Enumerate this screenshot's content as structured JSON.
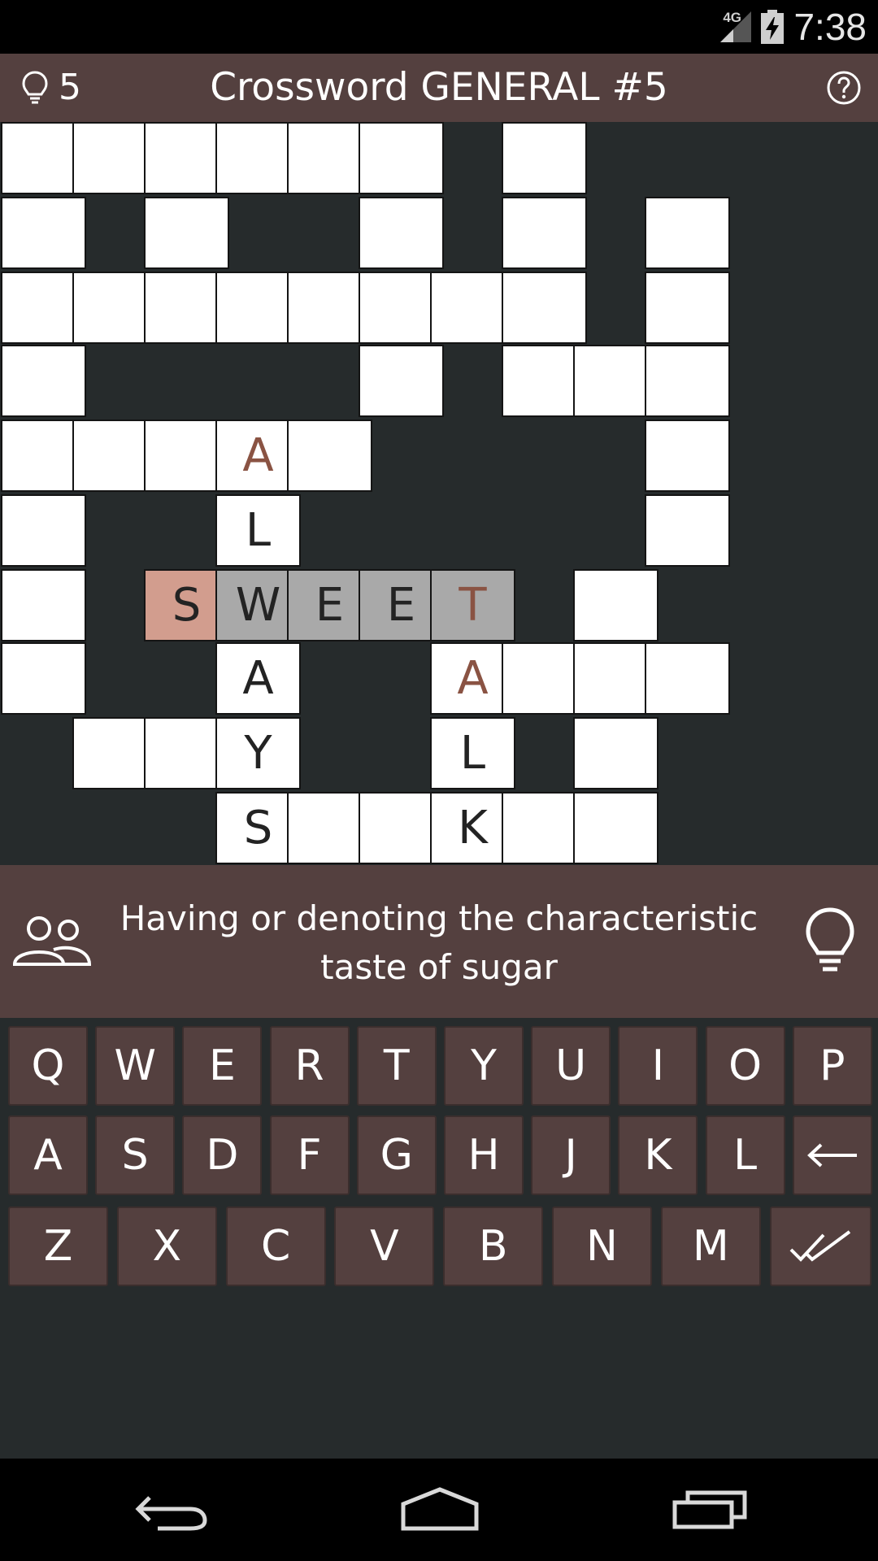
{
  "status_bar": {
    "network": "4G",
    "time": "7:38"
  },
  "header": {
    "hints_left": "5",
    "title": "Crossword GENERAL #5"
  },
  "grid": {
    "cells": [
      {
        "r": 0,
        "c": 0,
        "letter": ""
      },
      {
        "r": 0,
        "c": 1,
        "letter": ""
      },
      {
        "r": 0,
        "c": 2,
        "letter": ""
      },
      {
        "r": 0,
        "c": 3,
        "letter": ""
      },
      {
        "r": 0,
        "c": 4,
        "letter": ""
      },
      {
        "r": 0,
        "c": 5,
        "letter": ""
      },
      {
        "r": 0,
        "c": 7,
        "letter": ""
      },
      {
        "r": 1,
        "c": 0,
        "letter": ""
      },
      {
        "r": 1,
        "c": 2,
        "letter": ""
      },
      {
        "r": 1,
        "c": 5,
        "letter": ""
      },
      {
        "r": 1,
        "c": 7,
        "letter": ""
      },
      {
        "r": 1,
        "c": 9,
        "letter": ""
      },
      {
        "r": 2,
        "c": 0,
        "letter": ""
      },
      {
        "r": 2,
        "c": 1,
        "letter": ""
      },
      {
        "r": 2,
        "c": 2,
        "letter": ""
      },
      {
        "r": 2,
        "c": 3,
        "letter": ""
      },
      {
        "r": 2,
        "c": 4,
        "letter": ""
      },
      {
        "r": 2,
        "c": 5,
        "letter": ""
      },
      {
        "r": 2,
        "c": 6,
        "letter": ""
      },
      {
        "r": 2,
        "c": 7,
        "letter": ""
      },
      {
        "r": 2,
        "c": 9,
        "letter": ""
      },
      {
        "r": 3,
        "c": 0,
        "letter": ""
      },
      {
        "r": 3,
        "c": 5,
        "letter": ""
      },
      {
        "r": 3,
        "c": 7,
        "letter": ""
      },
      {
        "r": 3,
        "c": 8,
        "letter": ""
      },
      {
        "r": 3,
        "c": 9,
        "letter": ""
      },
      {
        "r": 4,
        "c": 0,
        "letter": ""
      },
      {
        "r": 4,
        "c": 1,
        "letter": ""
      },
      {
        "r": 4,
        "c": 2,
        "letter": ""
      },
      {
        "r": 4,
        "c": 3,
        "letter": "A",
        "state": "hinted"
      },
      {
        "r": 4,
        "c": 4,
        "letter": ""
      },
      {
        "r": 4,
        "c": 9,
        "letter": ""
      },
      {
        "r": 5,
        "c": 0,
        "letter": ""
      },
      {
        "r": 5,
        "c": 3,
        "letter": "L"
      },
      {
        "r": 5,
        "c": 9,
        "letter": ""
      },
      {
        "r": 6,
        "c": 0,
        "letter": ""
      },
      {
        "r": 6,
        "c": 2,
        "letter": "S",
        "state": "cursor"
      },
      {
        "r": 6,
        "c": 3,
        "letter": "W",
        "state": "active"
      },
      {
        "r": 6,
        "c": 4,
        "letter": "E",
        "state": "active"
      },
      {
        "r": 6,
        "c": 5,
        "letter": "E",
        "state": "active"
      },
      {
        "r": 6,
        "c": 6,
        "letter": "T",
        "state": "active-hinted"
      },
      {
        "r": 6,
        "c": 8,
        "letter": ""
      },
      {
        "r": 7,
        "c": 0,
        "letter": ""
      },
      {
        "r": 7,
        "c": 3,
        "letter": "A"
      },
      {
        "r": 7,
        "c": 6,
        "letter": "A",
        "state": "hinted"
      },
      {
        "r": 7,
        "c": 7,
        "letter": ""
      },
      {
        "r": 7,
        "c": 8,
        "letter": ""
      },
      {
        "r": 7,
        "c": 9,
        "letter": ""
      },
      {
        "r": 8,
        "c": 1,
        "letter": ""
      },
      {
        "r": 8,
        "c": 2,
        "letter": ""
      },
      {
        "r": 8,
        "c": 3,
        "letter": "Y"
      },
      {
        "r": 8,
        "c": 6,
        "letter": "L"
      },
      {
        "r": 8,
        "c": 8,
        "letter": ""
      },
      {
        "r": 9,
        "c": 3,
        "letter": "S"
      },
      {
        "r": 9,
        "c": 4,
        "letter": ""
      },
      {
        "r": 9,
        "c": 5,
        "letter": ""
      },
      {
        "r": 9,
        "c": 6,
        "letter": "K"
      },
      {
        "r": 9,
        "c": 7,
        "letter": ""
      },
      {
        "r": 9,
        "c": 8,
        "letter": ""
      }
    ]
  },
  "clue": {
    "text": "Having or denoting the characteristic taste of sugar"
  },
  "keyboard": {
    "row1": [
      "Q",
      "W",
      "E",
      "R",
      "T",
      "Y",
      "U",
      "I",
      "O",
      "P"
    ],
    "row2": [
      "A",
      "S",
      "D",
      "F",
      "G",
      "H",
      "J",
      "K",
      "L"
    ],
    "row3": [
      "Z",
      "X",
      "C",
      "V",
      "B",
      "N",
      "M"
    ]
  },
  "colors": {
    "header_bg": "#54403f",
    "board_bg": "#262b2c",
    "active_word": "#a9a9a9",
    "cursor_cell": "#d29d8e",
    "hinted_letter": "#8a5343"
  }
}
